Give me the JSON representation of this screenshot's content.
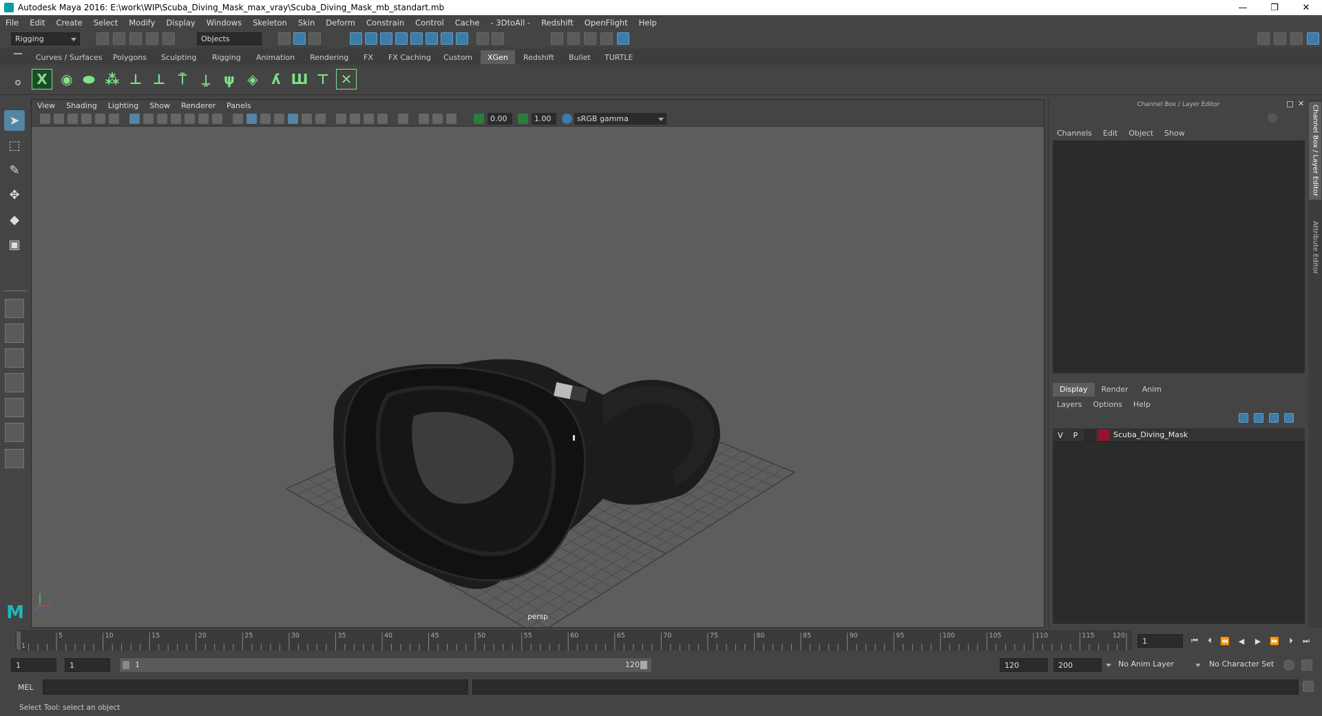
{
  "window": {
    "title": "Autodesk Maya 2016: E:\\work\\WIP\\Scuba_Diving_Mask_max_vray\\Scuba_Diving_Mask_mb_standart.mb",
    "minimize": "—",
    "maximize": "❐",
    "close": "✕"
  },
  "menus": [
    "File",
    "Edit",
    "Create",
    "Select",
    "Modify",
    "Display",
    "Windows",
    "Skeleton",
    "Skin",
    "Deform",
    "Constrain",
    "Control",
    "Cache",
    "- 3DtoAll -",
    "Redshift",
    "OpenFlight",
    "Help"
  ],
  "statusline": {
    "mode": "Rigging",
    "selection_mask": "Objects"
  },
  "shelf_tabs": [
    "Curves / Surfaces",
    "Polygons",
    "Sculpting",
    "Rigging",
    "Animation",
    "Rendering",
    "FX",
    "FX Caching",
    "Custom",
    "XGen",
    "Redshift",
    "Bullet",
    "TURTLE"
  ],
  "shelf_active_tab": "XGen",
  "viewport": {
    "menus": [
      "View",
      "Shading",
      "Lighting",
      "Show",
      "Renderer",
      "Panels"
    ],
    "exposure": "0.00",
    "gamma": "1.00",
    "color_space": "sRGB gamma",
    "camera_label": "persp"
  },
  "channel_box": {
    "title": "Channel Box / Layer Editor",
    "menus": [
      "Channels",
      "Edit",
      "Object",
      "Show"
    ],
    "layer_tabs": [
      "Display",
      "Render",
      "Anim"
    ],
    "layer_active_tab": "Display",
    "layer_menus": [
      "Layers",
      "Options",
      "Help"
    ],
    "layer": {
      "visible": "V",
      "playback": "P",
      "name": "Scuba_Diving_Mask",
      "color": "#9b1030"
    }
  },
  "side_tabs": [
    "Channel Box / Layer Editor",
    "Attribute Editor"
  ],
  "time_slider": {
    "ticks": [
      "1",
      "5",
      "10",
      "15",
      "20",
      "25",
      "30",
      "35",
      "40",
      "45",
      "50",
      "55",
      "60",
      "65",
      "70",
      "75",
      "80",
      "85",
      "90",
      "95",
      "100",
      "105",
      "110",
      "115",
      "120"
    ],
    "current_frame": "1"
  },
  "range_slider": {
    "start": "1",
    "anim_start": "1",
    "range_start_label": "1",
    "range_end_label": "120",
    "end": "120",
    "anim_end": "200",
    "anim_layer": "No Anim Layer",
    "character_set": "No Character Set"
  },
  "command_line": {
    "label": "MEL"
  },
  "help_line": "Select Tool: select an object",
  "accent": "#5285a6"
}
